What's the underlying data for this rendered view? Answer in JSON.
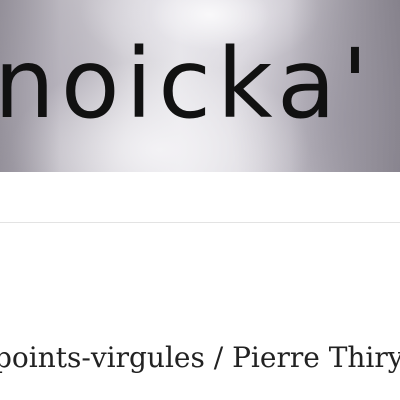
{
  "header": {
    "title": "noicka'"
  },
  "post": {
    "title": "points-virgules / Pierre Thiry"
  }
}
